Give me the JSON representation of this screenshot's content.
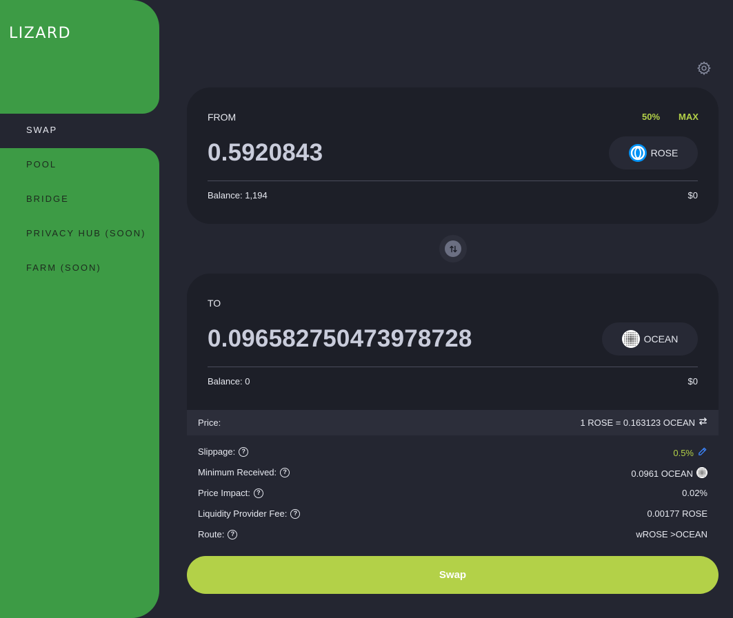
{
  "app": {
    "logo": "LIZARD"
  },
  "sidebar": {
    "items": [
      {
        "label": "SWAP",
        "active": true
      },
      {
        "label": "POOL"
      },
      {
        "label": "BRIDGE"
      },
      {
        "label": "PRIVACY HUB (SOON)"
      },
      {
        "label": "FARM (SOON)"
      }
    ]
  },
  "settings": {
    "icon": "gear-icon"
  },
  "from": {
    "label": "FROM",
    "pct_50": "50%",
    "max": "MAX",
    "amount": "0.5920843",
    "token": "ROSE",
    "token_icon": "rose-token-icon",
    "balance": "Balance: 1,194",
    "usd": "$0"
  },
  "switch": {
    "icon": "swap-arrows-icon"
  },
  "to": {
    "label": "TO",
    "amount": "0.096582750473978728",
    "token": "OCEAN",
    "token_icon": "ocean-token-icon",
    "balance": "Balance: 0",
    "usd": "$0"
  },
  "price": {
    "label": "Price:",
    "value": "1 ROSE = 0.163123 OCEAN"
  },
  "details": {
    "slippage_label": "Slippage:",
    "slippage_value": "0.5%",
    "min_received_label": "Minimum Received:",
    "min_received_value": "0.0961 OCEAN",
    "price_impact_label": "Price Impact:",
    "price_impact_value": "0.02%",
    "lp_fee_label": "Liquidity Provider Fee:",
    "lp_fee_value": "0.00177 ROSE",
    "route_label": "Route:",
    "route_value": "wROSE >OCEAN"
  },
  "action": {
    "swap_label": "Swap"
  },
  "colors": {
    "accent": "#b3d148",
    "sidebar": "#3d9b45",
    "background": "#242631",
    "card": "#1d1f28"
  }
}
